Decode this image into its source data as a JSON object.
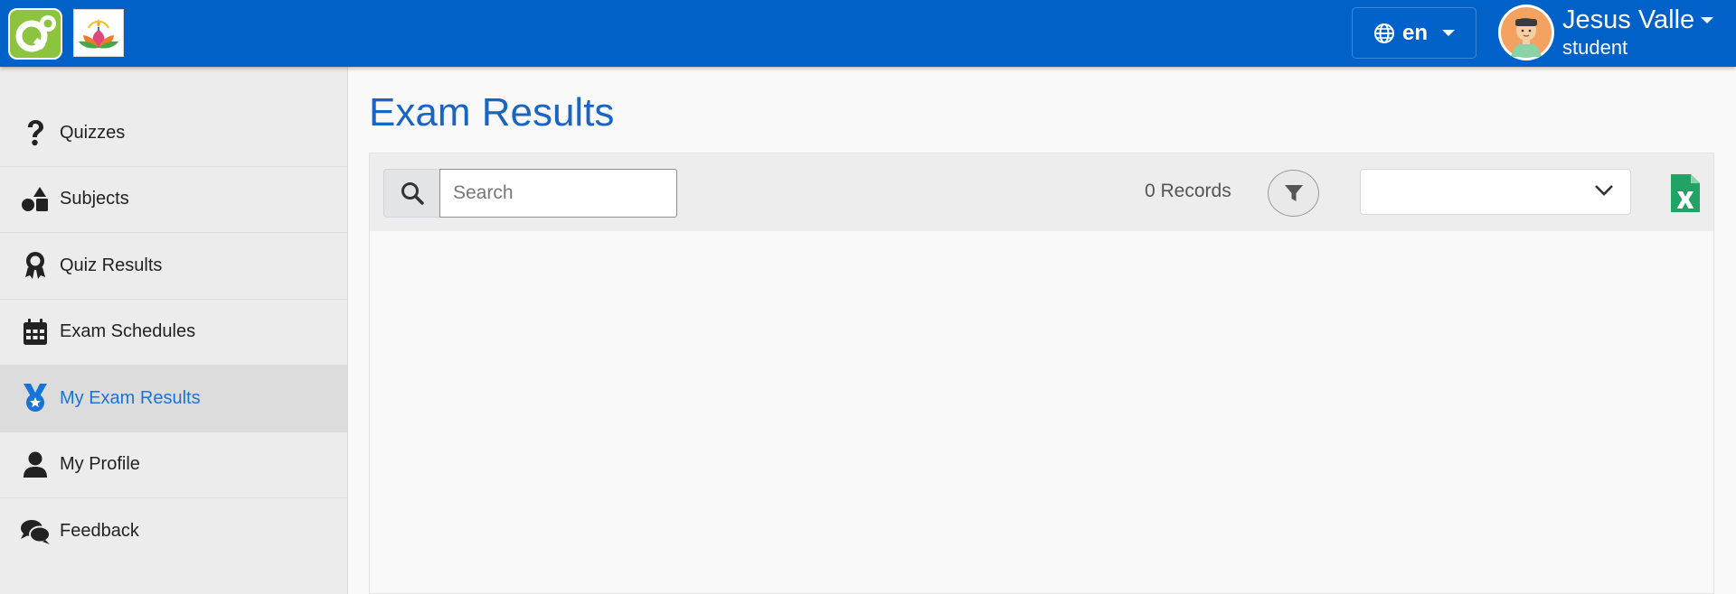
{
  "header": {
    "language": "en",
    "user_name": "Jesus Valle",
    "user_role": "student"
  },
  "sidebar": {
    "items": [
      {
        "label": "Quizzes",
        "icon": "question-icon"
      },
      {
        "label": "Subjects",
        "icon": "shapes-icon"
      },
      {
        "label": "Quiz Results",
        "icon": "award-icon"
      },
      {
        "label": "Exam Schedules",
        "icon": "calendar-icon"
      },
      {
        "label": "My Exam Results",
        "icon": "medal-icon",
        "active": true
      },
      {
        "label": "My Profile",
        "icon": "user-icon"
      },
      {
        "label": "Feedback",
        "icon": "comments-icon"
      }
    ]
  },
  "main": {
    "title": "Exam Results",
    "search_placeholder": "Search",
    "records": "0 Records",
    "select_value": ""
  },
  "colors": {
    "header_bg": "#0062c8",
    "accent": "#1a73d9",
    "logo_green": "#8cc43f",
    "excel_green": "#21a366"
  }
}
